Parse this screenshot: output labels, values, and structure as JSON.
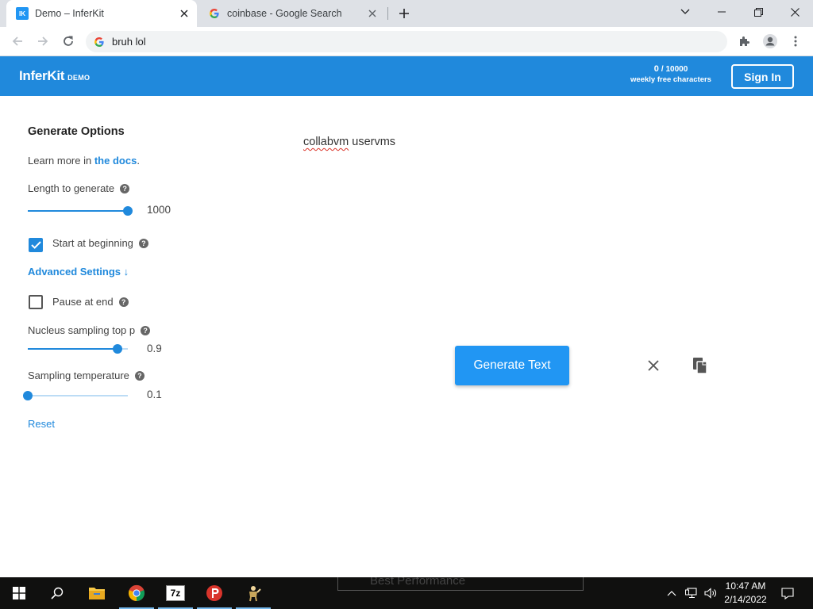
{
  "browser": {
    "tabs": [
      {
        "title": "Demo – InferKit",
        "favicon": "inferkit-icon",
        "active": true
      },
      {
        "title": "coinbase - Google Search",
        "favicon": "google-g-icon",
        "active": false
      }
    ],
    "address": "bruh lol"
  },
  "header": {
    "logo_name": "InferKit",
    "logo_badge": "DEMO",
    "usage_count": "0",
    "usage_limit": "/ 10000",
    "usage_label": "weekly free characters",
    "signin_label": "Sign In"
  },
  "options": {
    "title": "Generate Options",
    "learn_more_prefix": "Learn more in",
    "docs_link": "the docs",
    "learn_more_suffix": ".",
    "length_label": "Length to generate",
    "length_value": "1000",
    "length_fraction": 1.0,
    "start_label": "Start at beginning",
    "start_checked": true,
    "advanced_label": "Advanced Settings ↓",
    "pause_label": "Pause at end",
    "pause_checked": false,
    "nucleus_label": "Nucleus sampling top p",
    "nucleus_value": "0.9",
    "nucleus_fraction": 0.9,
    "temperature_label": "Sampling temperature",
    "temperature_value": "0.1",
    "temperature_fraction": 0.0,
    "reset_label": "Reset"
  },
  "editor": {
    "text_word1": "collabvm",
    "text_word2": "uservms",
    "generate_label": "Generate Text"
  },
  "taskbar": {
    "ghost_text": "Best Performance",
    "time": "10:47 AM",
    "date": "2/14/2022"
  },
  "colors": {
    "accent": "#2089dc",
    "button": "#2196f3",
    "taskbar": "#10100f"
  }
}
